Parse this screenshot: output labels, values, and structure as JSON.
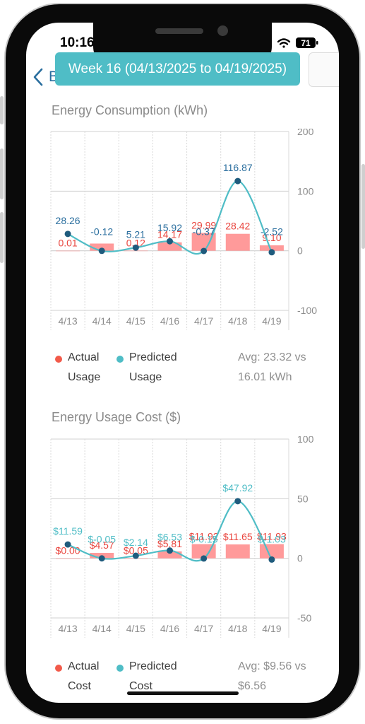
{
  "status_bar": {
    "time": "10:16",
    "battery": "71"
  },
  "nav": {
    "back_label": "Back"
  },
  "week_banner": {
    "label": "Week 16 (04/13/2025 to 04/19/2025)"
  },
  "colors": {
    "actual": "#ff9a9a",
    "actual_text": "#e9453e",
    "predicted_line": "#4fbdc6",
    "predicted_dot": "#1f5b7d",
    "banner": "#4fbdc6"
  },
  "consumption": {
    "title": "Energy Consumption (kWh)",
    "legend": {
      "actual_line1": "Actual",
      "actual_line2": "Usage",
      "predicted_line1": "Predicted",
      "predicted_line2": "Usage",
      "avg_line1": "Avg: 23.32 vs",
      "avg_line2": "16.01 kWh"
    }
  },
  "cost": {
    "title": "Energy Usage Cost ($)",
    "legend": {
      "actual_line1": "Actual",
      "actual_line2": "Cost",
      "predicted_line1": "Predicted",
      "predicted_line2": "Cost",
      "avg_line1": "Avg: $9.56 vs",
      "avg_line2": "$6.56"
    }
  },
  "chart_data": [
    {
      "type": "bar",
      "categories": [
        "4/13",
        "4/14",
        "4/15",
        "4/16",
        "4/17",
        "4/18",
        "4/19"
      ],
      "ylim": [
        -100,
        200
      ],
      "yticks": [
        200,
        100,
        0,
        -100
      ],
      "ytick_labels": [
        "200",
        "100",
        "0",
        "-100"
      ],
      "series": [
        {
          "name": "Actual Usage",
          "kind": "bar",
          "values": [
            0.01,
            12.09,
            0.12,
            14.17,
            29.99,
            28.42,
            9.1
          ],
          "labels": [
            "0.01",
            "",
            "0.12",
            "14.17",
            "29.99",
            "28.42",
            "9.10"
          ]
        },
        {
          "name": "Predicted Usage",
          "kind": "line",
          "values": [
            28.26,
            -0.12,
            5.21,
            15.92,
            -0.37,
            116.87,
            -2.52
          ],
          "labels": [
            "28.26",
            "-0.12",
            "5.21",
            "15.92",
            "-0.37",
            "116.87",
            "-2.52"
          ]
        }
      ]
    },
    {
      "type": "bar",
      "categories": [
        "4/13",
        "4/14",
        "4/15",
        "4/16",
        "4/17",
        "4/18",
        "4/19"
      ],
      "ylim": [
        -50,
        100
      ],
      "yticks": [
        100,
        50,
        0,
        -50
      ],
      "ytick_labels": [
        "100",
        "50",
        "0",
        "-50"
      ],
      "series": [
        {
          "name": "Actual Cost",
          "kind": "bar",
          "values": [
            0.0,
            4.57,
            0.05,
            5.81,
            11.92,
            11.65,
            11.93
          ],
          "labels": [
            "$0.00",
            "$4.57",
            "$0.05",
            "$5.81",
            "$11.92",
            "$11.65",
            "$11.93"
          ]
        },
        {
          "name": "Predicted Cost",
          "kind": "line",
          "values": [
            11.59,
            -0.05,
            2.14,
            6.53,
            -0.15,
            47.92,
            -1.03
          ],
          "labels": [
            "$11.59",
            "$-0.05",
            "$2.14",
            "$6.53",
            "$-0.15",
            "$47.92",
            "$-1.03"
          ]
        }
      ]
    }
  ]
}
